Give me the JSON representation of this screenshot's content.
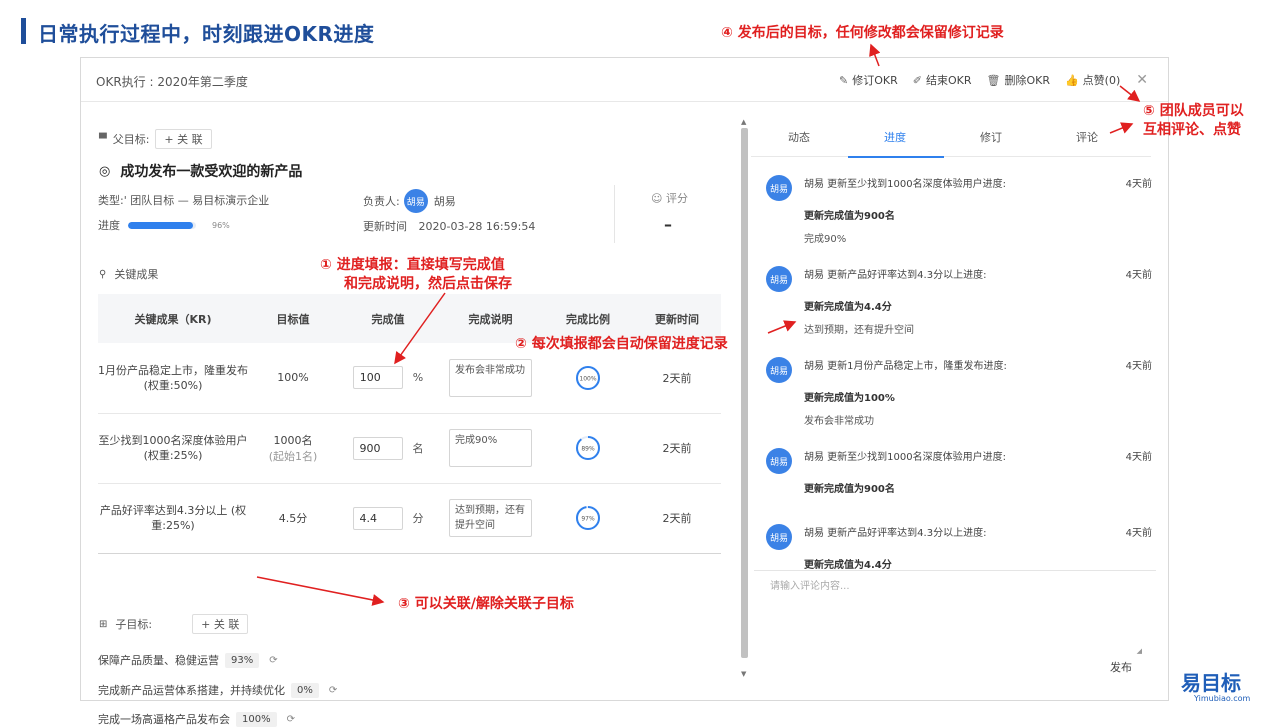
{
  "slide": {
    "title": "日常执行过程中，时刻跟进OKR进度",
    "logo_text": "易目标",
    "logo_sub": "Yimubiao.com"
  },
  "panel": {
    "title": "OKR执行 : 2020年第二季度",
    "actions": {
      "revise": "修订OKR",
      "finish": "结束OKR",
      "delete": "删除OKR",
      "like": "点赞(0)"
    }
  },
  "objective": {
    "parent_label": "父目标:",
    "link_label": "+ 关 联",
    "title": "成功发布一款受欢迎的新产品",
    "type_text": "类型:' 团队目标 — 易目标演示企业",
    "progress_label": "进度",
    "progress_pct": 96,
    "progress_text": "96%",
    "owner_label": "负责人:",
    "owner_name": "胡易",
    "avatar_text": "胡易",
    "updated_label": "更新时间",
    "updated_value": "2020-03-28 16:59:54",
    "score_label": "评分",
    "score_value": "–"
  },
  "key_results": {
    "section_label": "关键成果",
    "columns": [
      "关键成果（KR)",
      "目标值",
      "完成值",
      "完成说明",
      "完成比例",
      "更新时间"
    ],
    "rows": [
      {
        "name": "1月份产品稳定上市，隆重发布 (权重:50%)",
        "target": "100%",
        "target_sub": "",
        "value": "100",
        "unit": "%",
        "note": "发布会非常成功",
        "ratio_text": "100%",
        "ratio": 100,
        "updated": "2天前"
      },
      {
        "name": "至少找到1000名深度体验用户 (权重:25%)",
        "target": "1000名",
        "target_sub": "(起始1名)",
        "value": "900",
        "unit": "名",
        "note": "完成90%",
        "ratio_text": "89%",
        "ratio": 89,
        "updated": "2天前"
      },
      {
        "name": "产品好评率达到4.3分以上 (权重:25%)",
        "target": "4.5分",
        "target_sub": "",
        "value": "4.4",
        "unit": "分",
        "note": "达到预期，还有提升空间",
        "ratio_text": "97%",
        "ratio": 97,
        "updated": "2天前"
      }
    ]
  },
  "children": {
    "label": "子目标:",
    "link_label": "+ 关 联",
    "items": [
      {
        "name": "保障产品质量、稳健运营",
        "pct": "93%"
      },
      {
        "name": "完成新产品运营体系搭建，并持续优化",
        "pct": "0%"
      },
      {
        "name": "完成一场高逼格产品发布会",
        "pct": "100%"
      }
    ]
  },
  "right": {
    "tabs": [
      "动态",
      "进度",
      "修订",
      "评论"
    ],
    "active_tab": 1,
    "feed": [
      {
        "avatar": "胡易",
        "line": "胡易 更新至少找到1000名深度体验用户进度:",
        "time": "4天前",
        "value": "更新完成值为900名",
        "desc": "完成90%"
      },
      {
        "avatar": "胡易",
        "line": "胡易 更新产品好评率达到4.3分以上进度:",
        "time": "4天前",
        "value": "更新完成值为4.4分",
        "desc": "达到预期，还有提升空间"
      },
      {
        "avatar": "胡易",
        "line": "胡易 更新1月份产品稳定上市，隆重发布进度:",
        "time": "4天前",
        "value": "更新完成值为100%",
        "desc": "发布会非常成功"
      },
      {
        "avatar": "胡易",
        "line": "胡易 更新至少找到1000名深度体验用户进度:",
        "time": "4天前",
        "value": "更新完成值为900名",
        "desc": ""
      },
      {
        "avatar": "胡易",
        "line": "胡易 更新产品好评率达到4.3分以上进度:",
        "time": "4天前",
        "value": "更新完成值为4.4分",
        "desc": ""
      }
    ],
    "comment_placeholder": "请输入评论内容...",
    "publish_label": "发布"
  },
  "annotations": {
    "a1_line1": "① 进度填报：直接填写完成值",
    "a1_line2": "和完成说明，然后点击保存",
    "a2": "② 每次填报都会自动保留进度记录",
    "a3": "③ 可以关联/解除关联子目标",
    "a4": "④ 发布后的目标，任何修改都会保留修订记录",
    "a5_line1": "⑤ 团队成员可以",
    "a5_line2": "互相评论、点赞"
  },
  "colors": {
    "accent": "#2f80ed",
    "title_blue": "#1f4e9a",
    "annotation_red": "#e02020"
  }
}
